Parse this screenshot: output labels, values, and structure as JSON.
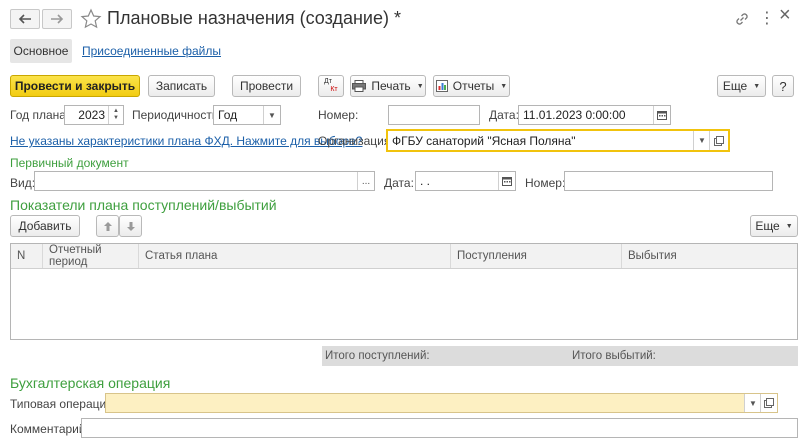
{
  "window": {
    "title": "Плановые назначения (создание) *",
    "menu_glyph": "⋮",
    "more_glyph": "⋮",
    "close_glyph": "×"
  },
  "tabs": {
    "main": "Основное",
    "files": "Присоединенные файлы"
  },
  "toolbar": {
    "post_close": "Провести и закрыть",
    "save": "Записать",
    "post": "Провести",
    "dtkt_top": "Дт",
    "dtkt_bottom": "Кт",
    "print": "Печать",
    "reports": "Отчеты",
    "more": "Еще"
  },
  "form": {
    "year_label": "Год плана:",
    "year_value": "2023",
    "period_label": "Периодичность:",
    "period_value": "Год",
    "number_label": "Номер:",
    "number_value": "",
    "date_label": "Дата:",
    "date_value": "11.01.2023  0:00:00",
    "fhd_link": "Не указаны характеристики плана ФХД. Нажмите для выбора?",
    "org_label": "Организация:",
    "org_value": "ФГБУ санаторий \"Ясная Поляна\""
  },
  "primary_doc": {
    "heading": "Первичный документ",
    "kind_label": "Вид:",
    "kind_value": "",
    "ellipsis": "...",
    "date_label": "Дата:",
    "date_value": " .  .",
    "number_label": "Номер:",
    "number_value": ""
  },
  "indicators": {
    "heading": "Показатели плана поступлений/выбытий",
    "add_button": "Добавить",
    "more": "Еще",
    "columns": [
      "N",
      "Отчетный период",
      "Статья плана",
      "Поступления",
      "Выбытия"
    ],
    "rows": [],
    "total_income_label": "Итого поступлений:",
    "total_outgo_label": "Итого выбытий:"
  },
  "accounting": {
    "heading": "Бухгалтерская операция",
    "op_label": "Типовая операция:",
    "op_value": "",
    "comment_label": "Комментарий:",
    "comment_value": ""
  }
}
